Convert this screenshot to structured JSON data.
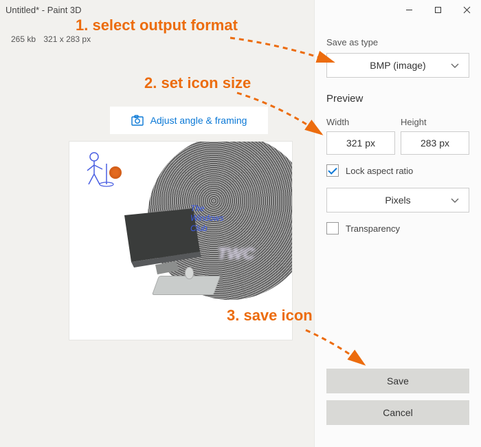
{
  "titlebar": {
    "title": "Untitled* - Paint 3D"
  },
  "fileinfo": {
    "size": "265 kb",
    "dims": "321 x 283 px"
  },
  "adjust": {
    "label": "Adjust angle & framing"
  },
  "canvas": {
    "wintext1": "The",
    "wintext2": "Windows",
    "wintext3": "Club",
    "twc": "TWC"
  },
  "panel": {
    "saveas_label": "Save as type",
    "format_selected": "BMP (image)",
    "preview_label": "Preview",
    "width_label": "Width",
    "height_label": "Height",
    "width_value": "321 px",
    "height_value": "283 px",
    "lock_label": "Lock aspect ratio",
    "units_selected": "Pixels",
    "transparency_label": "Transparency",
    "save_label": "Save",
    "cancel_label": "Cancel"
  },
  "annotations": {
    "a1": "1. select output format",
    "a2": "2. set icon size",
    "a3": "3. save icon"
  }
}
